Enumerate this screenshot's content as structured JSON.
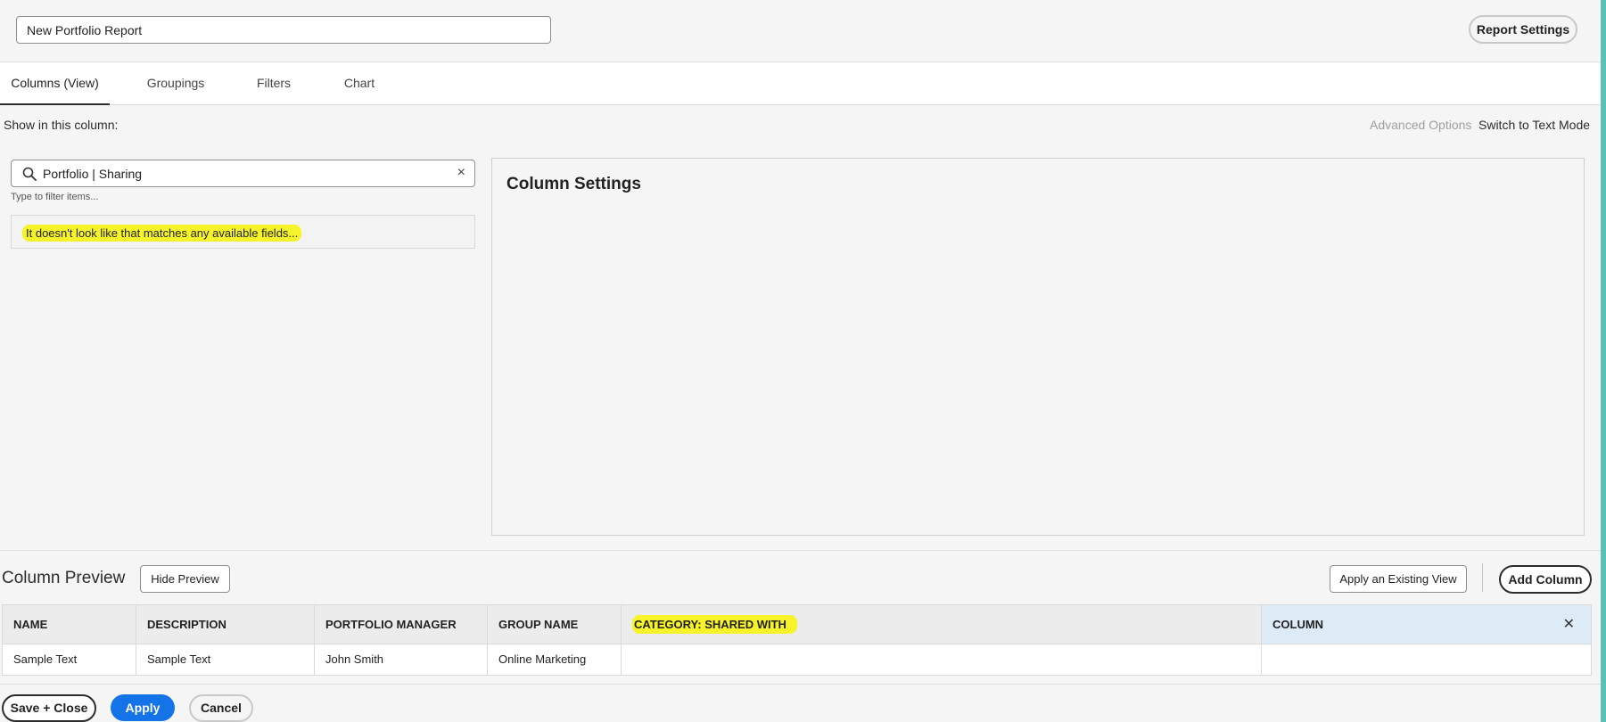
{
  "header": {
    "report_title_value": "New Portfolio Report",
    "report_settings_label": "Report Settings"
  },
  "tabs": [
    {
      "label": "Columns (View)",
      "active": true
    },
    {
      "label": "Groupings",
      "active": false
    },
    {
      "label": "Filters",
      "active": false
    },
    {
      "label": "Chart",
      "active": false
    }
  ],
  "column_editor": {
    "show_label": "Show in this column:",
    "advanced_options_label": "Advanced Options",
    "switch_text_mode_label": "Switch to Text Mode",
    "search": {
      "value": "Portfolio | Sharing",
      "hint": "Type to filter items..."
    },
    "no_match_message": "It doesn't look like that matches any available fields...",
    "settings_title": "Column Settings"
  },
  "preview": {
    "title": "Column Preview",
    "hide_preview_label": "Hide Preview",
    "apply_existing_view_label": "Apply an Existing View",
    "add_column_label": "Add Column",
    "columns": [
      "NAME",
      "DESCRIPTION",
      "PORTFOLIO MANAGER",
      "GROUP NAME",
      "CATEGORY: SHARED WITH",
      "COLUMN"
    ],
    "row": [
      "Sample Text",
      "Sample Text",
      "John Smith",
      "Online Marketing",
      "",
      ""
    ]
  },
  "footer": {
    "save_close_label": "Save + Close",
    "apply_label": "Apply",
    "cancel_label": "Cancel"
  },
  "colors": {
    "primary": "#1473e6",
    "highlight": "#f6f32a",
    "selected_column_header": "#ddebf6",
    "right_accent": "#5bc0b6"
  },
  "icons": {
    "search": "search-icon",
    "clear": "close-icon",
    "remove_column": "close-icon"
  }
}
